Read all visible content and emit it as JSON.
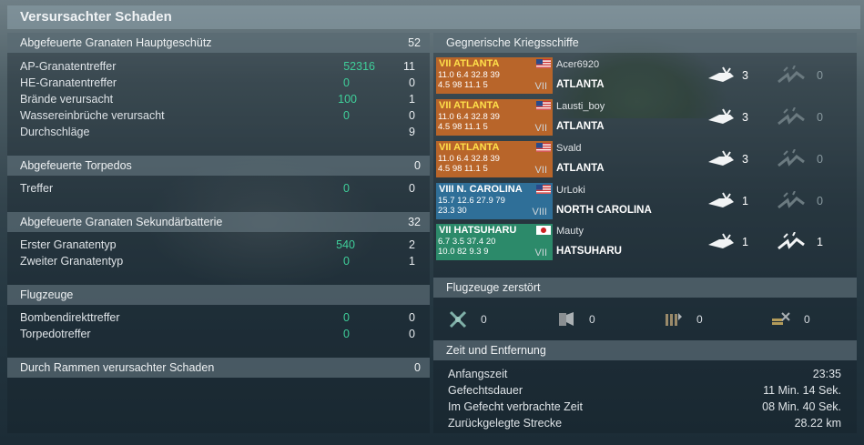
{
  "title": "Versursachter Schaden",
  "left": {
    "main_guns": {
      "header": "Abgefeuerte Granaten Hauptgeschütz",
      "total": "52",
      "rows": [
        {
          "label": "AP-Granatentreffer",
          "damage": "52316",
          "count": "11"
        },
        {
          "label": "HE-Granatentreffer",
          "damage": "0",
          "count": "0"
        },
        {
          "label": "Brände verursacht",
          "damage": "100",
          "count": "1"
        },
        {
          "label": "Wassereinbrüche verursacht",
          "damage": "0",
          "count": "0"
        },
        {
          "label": "Durchschläge",
          "damage": "",
          "count": "9"
        }
      ]
    },
    "torpedoes": {
      "header": "Abgefeuerte Torpedos",
      "total": "0",
      "rows": [
        {
          "label": "Treffer",
          "damage": "0",
          "count": "0"
        }
      ]
    },
    "secondary": {
      "header": "Abgefeuerte Granaten Sekundärbatterie",
      "total": "32",
      "rows": [
        {
          "label": "Erster Granatentyp",
          "damage": "540",
          "count": "2"
        },
        {
          "label": "Zweiter Granatentyp",
          "damage": "0",
          "count": "1"
        }
      ]
    },
    "aircraft": {
      "header": "Flugzeuge",
      "rows": [
        {
          "label": "Bombendirekttreffer",
          "damage": "0",
          "count": "0"
        },
        {
          "label": "Torpedotreffer",
          "damage": "0",
          "count": "0"
        }
      ]
    },
    "ramming": {
      "header": "Durch Rammen verursachter Schaden",
      "total": "0"
    }
  },
  "right": {
    "enemy_header": "Gegnerische Kriegsschiffe",
    "ships": [
      {
        "tier_label": "VII ATLANTA",
        "stats1": "11.0 6.4  32.8 39",
        "stats2": "4.5 98  11.1 5",
        "tier_roman": "VII",
        "player": "Acer6920",
        "ship": "ATLANTA",
        "damaged": "3",
        "destroyed": "0",
        "color": "#b8652a",
        "tier_color": "#ffe04a",
        "flag": "us"
      },
      {
        "tier_label": "VII ATLANTA",
        "stats1": "11.0 6.4  32.8 39",
        "stats2": "4.5 98  11.1 5",
        "tier_roman": "VII",
        "player": "Lausti_boy",
        "ship": "ATLANTA",
        "damaged": "3",
        "destroyed": "0",
        "color": "#b8652a",
        "tier_color": "#ffe04a",
        "flag": "us"
      },
      {
        "tier_label": "VII ATLANTA",
        "stats1": "11.0 6.4  32.8 39",
        "stats2": "4.5 98  11.1 5",
        "tier_roman": "VII",
        "player": "Svald",
        "ship": "ATLANTA",
        "damaged": "3",
        "destroyed": "0",
        "color": "#b8652a",
        "tier_color": "#ffe04a",
        "flag": "us"
      },
      {
        "tier_label": "VIII N. CAROLINA",
        "stats1": "15.7 12.6  27.9 79",
        "stats2": "23.3 30",
        "tier_roman": "VIII",
        "player": "UrLoki",
        "ship": "NORTH CAROLINA",
        "damaged": "1",
        "destroyed": "0",
        "color": "#2f6f98",
        "tier_color": "#ffffff",
        "flag": "us"
      },
      {
        "tier_label": "VII HATSUHARU",
        "stats1": "6.7 3.5  37.4 20",
        "stats2": "10.0 82  9.3 9",
        "tier_roman": "VII",
        "player": "Mauty",
        "ship": "HATSUHARU",
        "damaged": "1",
        "destroyed": "1",
        "color": "#2c8a6a",
        "tier_color": "#ffffff",
        "flag": "jp"
      }
    ],
    "planes_header": "Flugzeuge zerstört",
    "planes": [
      {
        "icon": "fighter-icon",
        "count": "0"
      },
      {
        "icon": "torpedo-bomber-icon",
        "count": "0"
      },
      {
        "icon": "dive-bomber-icon",
        "count": "0"
      },
      {
        "icon": "spotter-icon",
        "count": "0"
      }
    ],
    "time_header": "Zeit und Entfernung",
    "time_rows": [
      {
        "label": "Anfangszeit",
        "value": "23:35"
      },
      {
        "label": "Gefechtsdauer",
        "value": "11 Min. 14 Sek."
      },
      {
        "label": "Im Gefecht verbrachte Zeit",
        "value": "08 Min. 40 Sek."
      },
      {
        "label": "Zurückgelegte Strecke",
        "value": "28.22 km"
      }
    ]
  }
}
